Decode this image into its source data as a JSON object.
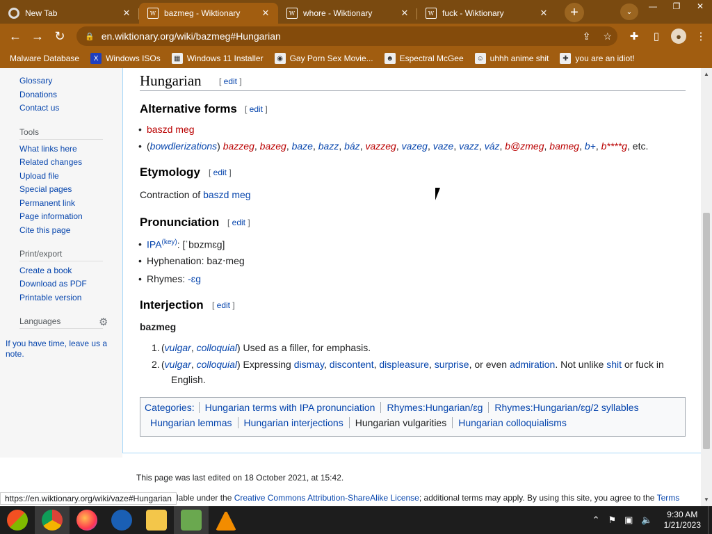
{
  "browser": {
    "tabs": [
      {
        "title": "New Tab",
        "favicon": "chrome-icon"
      },
      {
        "title": "bazmeg - Wiktionary",
        "favicon": "W"
      },
      {
        "title": "whore - Wiktionary",
        "favicon": "W"
      },
      {
        "title": "fuck - Wiktionary",
        "favicon": "W"
      }
    ],
    "active_tab": 1,
    "url": "en.wiktionary.org/wiki/bazmeg#Hungarian",
    "bookmarks": [
      "Malware Database",
      "Windows ISOs",
      "Windows 11 Installer",
      "Gay Porn Sex Movie...",
      "Espectral McGee",
      "uhhh anime shit",
      "you are an idiot!"
    ],
    "status_url": "https://en.wiktionary.org/wiki/vaze#Hungarian"
  },
  "sidebar": {
    "top_links": [
      "Glossary",
      "Donations",
      "Contact us"
    ],
    "tools_heading": "Tools",
    "tools": [
      "What links here",
      "Related changes",
      "Upload file",
      "Special pages",
      "Permanent link",
      "Page information",
      "Cite this page"
    ],
    "print_heading": "Print/export",
    "print": [
      "Create a book",
      "Download as PDF",
      "Printable version"
    ],
    "languages_heading": "Languages",
    "languages_note": "If you have time, leave us a note."
  },
  "article": {
    "language": "Hungarian",
    "edit": "edit",
    "alt_forms_heading": "Alternative forms",
    "alt_form_1": "baszd meg",
    "bowdlerizations_label": "bowdlerizations",
    "bowdlerizations": [
      "bazzeg",
      "bazeg",
      "baze",
      "bazz",
      "báz",
      "vazzeg",
      "vazeg",
      "vaze",
      "vazz",
      "váz",
      "b@zmeg",
      "bameg",
      "b+",
      "b****g"
    ],
    "etc": ", etc.",
    "etymology_heading": "Etymology",
    "etymology_text": "Contraction of ",
    "etymology_link_1": "baszd",
    "etymology_link_2": "meg",
    "pronunciation_heading": "Pronunciation",
    "ipa_label": "IPA",
    "ipa_key": "(key)",
    "ipa_value": ": [ˈbɒzmɛɡ]",
    "hyphenation": "Hyphenation: baz‧meg",
    "rhymes_label": "Rhymes: ",
    "rhymes_value": "-ɛɡ",
    "interjection_heading": "Interjection",
    "headword": "bazmeg",
    "senses": [
      {
        "num": "1.",
        "labels": [
          "vulgar",
          "colloquial"
        ],
        "text": " Used as a filler, for emphasis."
      },
      {
        "num": "2.",
        "labels": [
          "vulgar",
          "colloquial"
        ],
        "text_a": " Expressing ",
        "links": [
          "dismay",
          "discontent",
          "displeasure",
          "surprise"
        ],
        "text_b": ", or even ",
        "link_b": "admiration",
        "text_c": ". Not unlike ",
        "link_c": "shit",
        "text_d": " or fuck in",
        "text_e": "English."
      }
    ],
    "categories_label": "Categories",
    "categories": [
      "Hungarian terms with IPA pronunciation",
      "Rhymes:Hungarian/ɛɡ",
      "Rhymes:Hungarian/ɛɡ/2 syllables",
      "Hungarian lemmas",
      "Hungarian interjections",
      "Hungarian vulgarities",
      "Hungarian colloquialisms"
    ]
  },
  "footer": {
    "last_edited": "This page was last edited on 18 October 2021, at 15:42.",
    "license_a": "lable under the ",
    "license_link": "Creative Commons Attribution-ShareAlike License",
    "license_b": "; additional terms may apply. By using this site, you agree to the ",
    "terms": "Terms"
  },
  "taskbar": {
    "time": "9:30 AM",
    "date": "1/21/2023"
  }
}
